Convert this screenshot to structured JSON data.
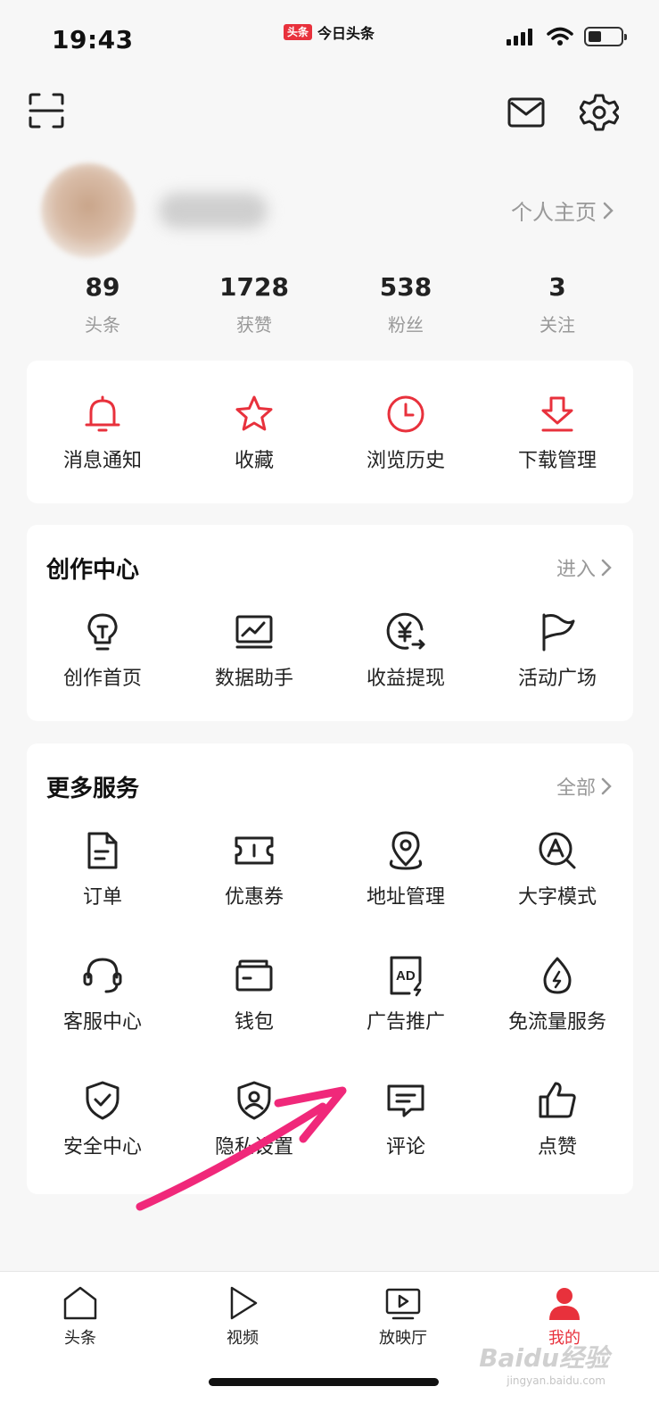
{
  "status_bar": {
    "time": "19:43",
    "app_badge_logo": "头条",
    "app_badge_name": "今日头条"
  },
  "header": {
    "scan_icon": "scan-icon",
    "mail_icon": "mail-icon",
    "settings_icon": "gear-icon"
  },
  "profile": {
    "homepage_link": "个人主页"
  },
  "stats": [
    {
      "value": "89",
      "label": "头条"
    },
    {
      "value": "1728",
      "label": "获赞"
    },
    {
      "value": "538",
      "label": "粉丝"
    },
    {
      "value": "3",
      "label": "关注"
    }
  ],
  "quick_actions": [
    {
      "label": "消息通知",
      "icon": "bell-icon"
    },
    {
      "label": "收藏",
      "icon": "star-icon"
    },
    {
      "label": "浏览历史",
      "icon": "clock-icon"
    },
    {
      "label": "下载管理",
      "icon": "download-icon"
    }
  ],
  "creator_center": {
    "title": "创作中心",
    "link": "进入",
    "items": [
      {
        "label": "创作首页",
        "icon": "lightbulb-icon"
      },
      {
        "label": "数据助手",
        "icon": "chart-monitor-icon"
      },
      {
        "label": "收益提现",
        "icon": "yuan-withdraw-icon"
      },
      {
        "label": "活动广场",
        "icon": "flag-icon"
      }
    ]
  },
  "more_services": {
    "title": "更多服务",
    "link": "全部",
    "items": [
      {
        "label": "订单",
        "icon": "document-icon"
      },
      {
        "label": "优惠券",
        "icon": "coupon-icon"
      },
      {
        "label": "地址管理",
        "icon": "location-pin-icon"
      },
      {
        "label": "大字模式",
        "icon": "large-font-icon"
      },
      {
        "label": "客服中心",
        "icon": "headset-icon"
      },
      {
        "label": "钱包",
        "icon": "wallet-icon"
      },
      {
        "label": "广告推广",
        "icon": "ad-icon"
      },
      {
        "label": "免流量服务",
        "icon": "data-drop-icon"
      },
      {
        "label": "安全中心",
        "icon": "shield-check-icon"
      },
      {
        "label": "隐私设置",
        "icon": "privacy-shield-icon"
      },
      {
        "label": "评论",
        "icon": "comment-icon"
      },
      {
        "label": "点赞",
        "icon": "thumbs-up-icon"
      }
    ]
  },
  "bottom_nav": [
    {
      "label": "头条",
      "icon": "home-icon"
    },
    {
      "label": "视频",
      "icon": "play-icon"
    },
    {
      "label": "放映厅",
      "icon": "tv-play-icon"
    },
    {
      "label": "我的",
      "icon": "user-icon"
    }
  ],
  "watermark": {
    "text": "Baidu经验",
    "sub": "jingyan.baidu.com"
  },
  "colors": {
    "accent": "#e8313c",
    "annotation_arrow": "#f0287a",
    "background": "#f7f7f7"
  }
}
